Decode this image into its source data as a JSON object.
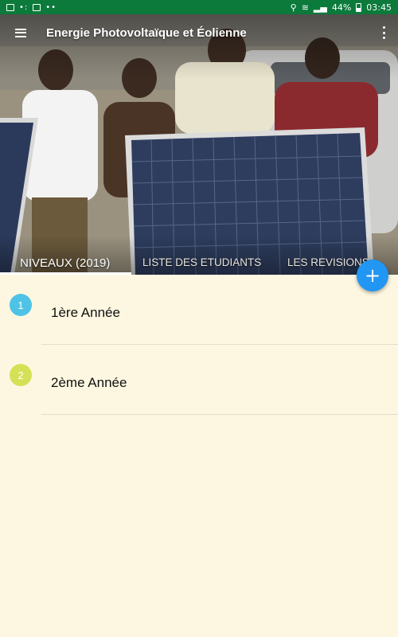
{
  "status_bar": {
    "battery": "44%",
    "time": "03:45"
  },
  "app_bar": {
    "title": "Energie Photovoltaïque et Éolienne",
    "menu_icon": "menu-icon",
    "overflow_icon": "more-vert-icon"
  },
  "tabs": [
    {
      "label": "NIVEAUX (2019)",
      "active": true
    },
    {
      "label": "LISTE DES ETUDIANTS",
      "active": false
    },
    {
      "label": "LES REVISIONS",
      "active": false
    }
  ],
  "fab": {
    "label": "+",
    "icon": "add-icon",
    "color": "#2196f3"
  },
  "levels": [
    {
      "number": "1",
      "label": "1ère Année",
      "color": "#4fc3e6"
    },
    {
      "number": "2",
      "label": "2ème Année",
      "color": "#d4e157"
    }
  ],
  "colors": {
    "status_bar": "#0b7a3b",
    "background": "#fdf7e1",
    "accent": "#2196f3"
  }
}
